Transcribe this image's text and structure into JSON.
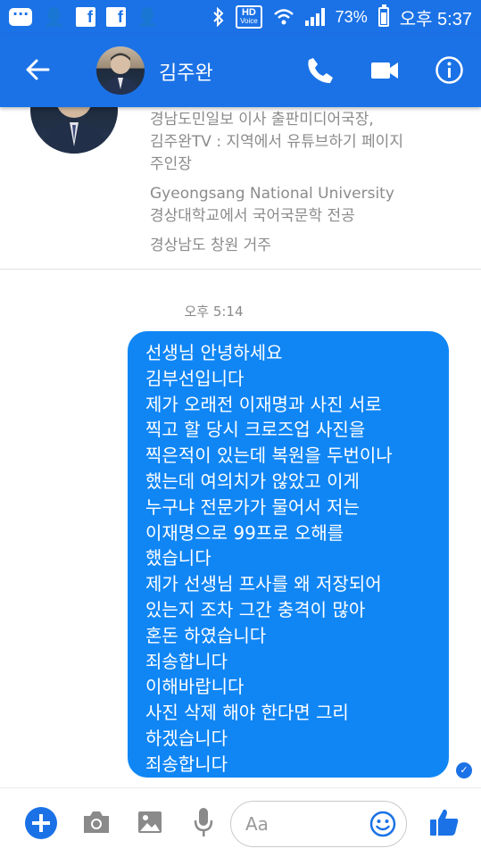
{
  "status_bar": {
    "voice_hd_top": "HD",
    "voice_hd_bottom": "Voice",
    "battery_percent": "73%",
    "time": "오후 5:37"
  },
  "header": {
    "contact_name": "김주완"
  },
  "profile": {
    "lines": [
      "경남도민일보 이사 출판미디어국장,",
      "김주완TV : 지역에서 유튜브하기 페이지",
      "주인장"
    ],
    "education_lines": [
      "Gyeongsang National University",
      "경상대학교에서 국어국문학 전공"
    ],
    "location": "경상남도 창원 거주"
  },
  "chat": {
    "timestamp": "오후 5:14",
    "message_lines": [
      "선생님  안녕하세요",
      "김부선입니다",
      "제가 오래전 이재명과 사진 서로",
      "찍고 할 당시 크로즈업 사진을",
      "찍은적이 있는데 복원을 두번이나",
      "했는데 여의치가 않았고 이게",
      "누구냐 전문가가 물어서 저는",
      "이재명으로 99프로 오해를",
      "했습니다",
      "제가 선생님 프사를 왜 저장되어",
      "있는지 조차 그간 충격이 많아",
      "혼돈 하였습니다",
      "죄송합니다",
      "이해바랍니다",
      "사진 삭제 해야 한다면 그리",
      "하겠습니다",
      "죄송합니다"
    ]
  },
  "composer": {
    "placeholder": "Aa"
  },
  "colors": {
    "brand_blue": "#1b72e6",
    "bubble_blue": "#1086f5"
  }
}
